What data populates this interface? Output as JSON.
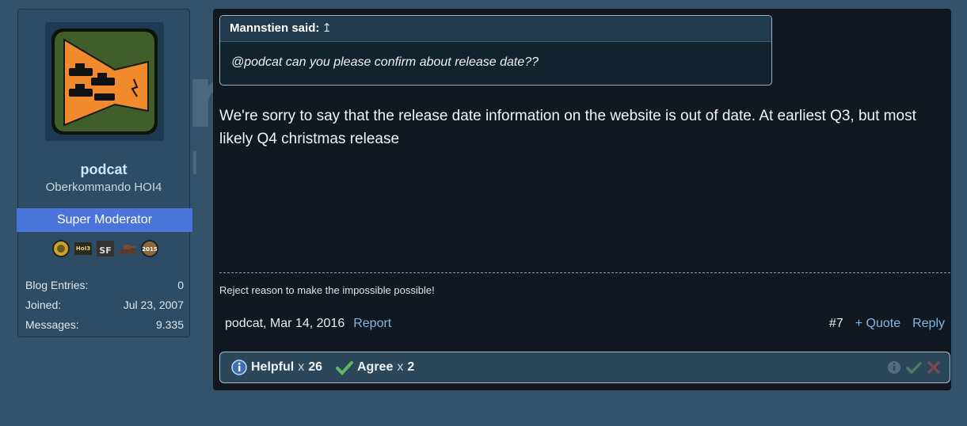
{
  "user": {
    "name": "podcat",
    "title": "Oberkommando HOI4",
    "role": "Super Moderator",
    "badge_icons": [
      "medal-icon",
      "hoi3-icon",
      "sf-icon",
      "tank-icon",
      "2015-icon"
    ],
    "badge_texts": {
      "hoi3": "HoI3",
      "sf": "SF",
      "year": "2015"
    },
    "stats": [
      {
        "label": "Blog Entries:",
        "value": "0"
      },
      {
        "label": "Joined:",
        "value": "Jul 23, 2007"
      },
      {
        "label": "Messages:",
        "value": "9.335"
      }
    ]
  },
  "quote": {
    "author": "Mannstien said:",
    "arrow": "↥",
    "text": "@podcat can you please confirm about release date??"
  },
  "post": {
    "text": "We're sorry to say that the release date information on the website is out of date. At earliest Q3, but most likely Q4 christmas release",
    "signature": "Reject reason to make the impossible possible!",
    "author_date": "podcat, Mar 14, 2016",
    "report": "Report",
    "number": "#7",
    "quote_link": "+ Quote",
    "reply_link": "Reply"
  },
  "reactions": {
    "helpful_label": "Helpful",
    "helpful_x": "x",
    "helpful_count": "26",
    "agree_label": "Agree",
    "agree_x": "x",
    "agree_count": "2"
  },
  "colors": {
    "page_bg": "#34536b",
    "post_bg": "#111820",
    "role_banner": "#4a74d9",
    "link": "#7fb8e8",
    "agree_green": "#5cb85c",
    "avatar_orange": "#f08a2c",
    "avatar_green": "#3f5e2a"
  }
}
